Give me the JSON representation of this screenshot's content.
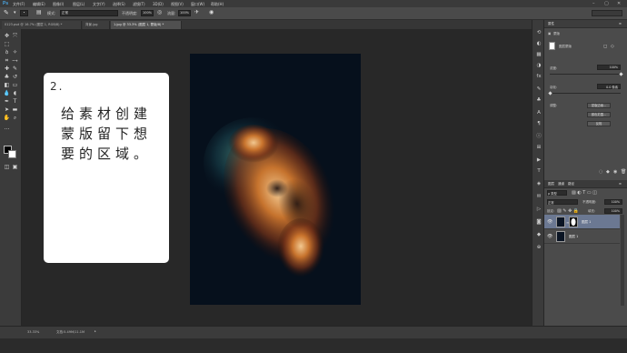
{
  "app": {
    "logo": "Ps"
  },
  "menu": [
    "文件(F)",
    "编辑(E)",
    "图像(I)",
    "图层(L)",
    "文字(Y)",
    "选择(S)",
    "滤镜(T)",
    "3D(D)",
    "视图(V)",
    "窗口(W)",
    "帮助(H)"
  ],
  "window_controls": {
    "minimize": "–",
    "restore": "▢",
    "close": "✕"
  },
  "options_bar": {
    "mode_label": "模式:",
    "mode_value": "正常",
    "opacity_label": "不透明度:",
    "opacity_value": "100%",
    "flow_label": "流量:",
    "flow_value": "100%"
  },
  "tabs": [
    {
      "label": "0123.psd @ 16.7% (图层 1, RGB/8) *",
      "active": false
    },
    {
      "label": "背景.jpg",
      "active": false
    },
    {
      "label": "1.jpg @ 33.3% (图层 1, 蒙版/8) *",
      "active": true
    }
  ],
  "overlay": {
    "step": "2.",
    "lines": [
      "给素材创建",
      "蒙版留下想",
      "要的区域。"
    ]
  },
  "status": {
    "zoom": "33.33%",
    "doc": "文档:5.49M/11.1M"
  },
  "panels": {
    "properties": {
      "tab": "属性",
      "mask_label": "蒙版",
      "layer_mask_label": "图层蒙版",
      "density_label": "浓度:",
      "density_value": "100%",
      "feather_label": "羽化:",
      "feather_value": "0.0 像素",
      "refine_label": "调整:",
      "buttons": [
        "蒙版边缘...",
        "颜色范围...",
        "反相"
      ]
    },
    "layers": {
      "tabs": [
        "图层",
        "通道",
        "路径"
      ],
      "kind_label": "ρ 类型",
      "blend_mode": "正常",
      "opacity_label": "不透明度:",
      "opacity_value": "100%",
      "lock_label": "锁定:",
      "fill_label": "填充:",
      "fill_value": "100%",
      "rows": [
        {
          "name": "图层 1",
          "selected": true
        },
        {
          "name": "图层 1",
          "selected": false
        }
      ]
    }
  },
  "colors": {
    "accent": "#4aa3df",
    "selected_layer": "#6b7892",
    "image_bg": "#06101c"
  }
}
